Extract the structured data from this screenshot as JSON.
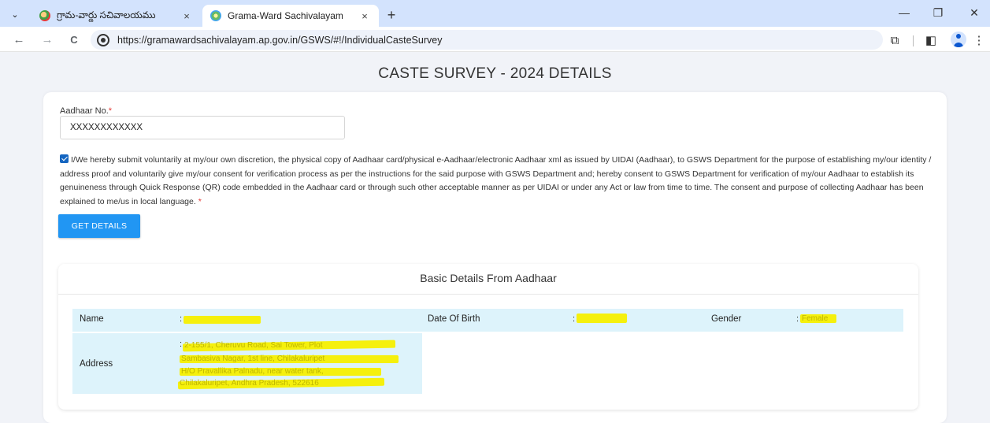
{
  "browser": {
    "tabs": [
      {
        "title": "గ్రామ-వార్డు సచివాలయము",
        "active": false
      },
      {
        "title": "Grama-Ward Sachivalayam",
        "active": true
      }
    ],
    "close_glyph": "×",
    "new_tab_glyph": "+",
    "tab_menu_glyph": "⌄",
    "window_controls": {
      "minimize": "—",
      "restore": "❐",
      "close": "✕"
    },
    "nav": {
      "back": "←",
      "forward": "→",
      "reload": "C"
    },
    "url": "https://gramawardsachivalayam.ap.gov.in/GSWS/#!/IndividualCasteSurvey",
    "toolbar_icons": [
      "extensions-icon",
      "sidepanel-icon",
      "profile-icon",
      "kebab-menu-icon"
    ],
    "toolbar_glyphs": {
      "extensions": "⧉",
      "sidepanel": "◧",
      "menu": "⋮"
    }
  },
  "page": {
    "title": "CASTE SURVEY - 2024 DETAILS",
    "aadhaar": {
      "label": "Aadhaar No.",
      "required_mark": "*",
      "value": "XXXXXXXXXXXX"
    },
    "consent": {
      "checked": true,
      "text": "I/We hereby submit voluntarily at my/our own discretion, the physical copy of Aadhaar card/physical e-Aadhaar/electronic Aadhaar xml as issued by UIDAI (Aadhaar), to GSWS Department for the purpose of establishing my/our identity / address proof and voluntarily give my/our consent for verification process as per the instructions for the said purpose with GSWS Department and; hereby consent to GSWS Department for verification of my/our Aadhaar to establish its genuineness through Quick Response (QR) code embedded in the Aadhaar card or through such other acceptable manner as per UIDAI or under any Act or law from time to time. The consent and purpose of collecting Aadhaar has been explained to me/us in local language.",
      "required_mark": "*"
    },
    "get_details_button": "GET DETAILS",
    "basic_details": {
      "title": "Basic Details From Aadhaar",
      "colon": ":",
      "name_label": "Name",
      "dob_label": "Date Of Birth",
      "gender_label": "Gender",
      "gender_value": "Female",
      "address_label": "Address",
      "address_lines": [
        "2-155/1, Cheruvu Road, Sai Tower, Plot",
        "Sambasiva Nagar, 1st line, Chilakaluripet",
        "H/O Pravallika Palnadu, near water tank,",
        "Chilakaluripet, Andhra Pradesh, 522616"
      ],
      "redaction_color": "#f5ef00"
    }
  }
}
